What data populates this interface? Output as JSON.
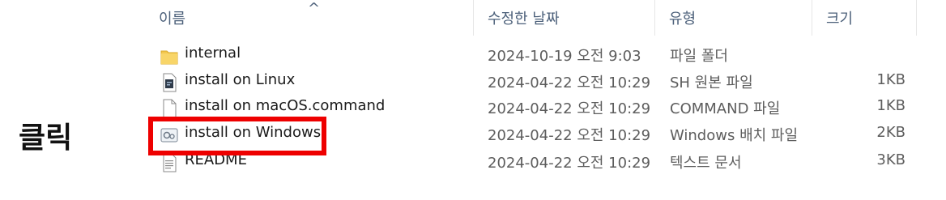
{
  "header": {
    "name": "이름",
    "date": "수정한 날짜",
    "type": "유형",
    "size": "크기",
    "sort_indicator": "^"
  },
  "files": [
    {
      "name": "internal",
      "date": "2024-10-19 오전 9:03",
      "type": "파일 폴더",
      "size": "",
      "icon": "folder-icon"
    },
    {
      "name": "install on Linux",
      "date": "2024-04-22 오전 10:29",
      "type": "SH 원본 파일",
      "size": "1KB",
      "icon": "script-file-icon"
    },
    {
      "name": "install on macOS.command",
      "date": "2024-04-22 오전 10:29",
      "type": "COMMAND 파일",
      "size": "1KB",
      "icon": "blank-file-icon"
    },
    {
      "name": "install on Windows",
      "date": "2024-04-22 오전 10:29",
      "type": "Windows 배치 파일",
      "size": "2KB",
      "icon": "batch-file-icon"
    },
    {
      "name": "README",
      "date": "2024-04-22 오전 10:29",
      "type": "텍스트 문서",
      "size": "3KB",
      "icon": "text-file-icon"
    }
  ],
  "annotation": {
    "label": "클릭",
    "highlight_color": "#ee0000"
  }
}
